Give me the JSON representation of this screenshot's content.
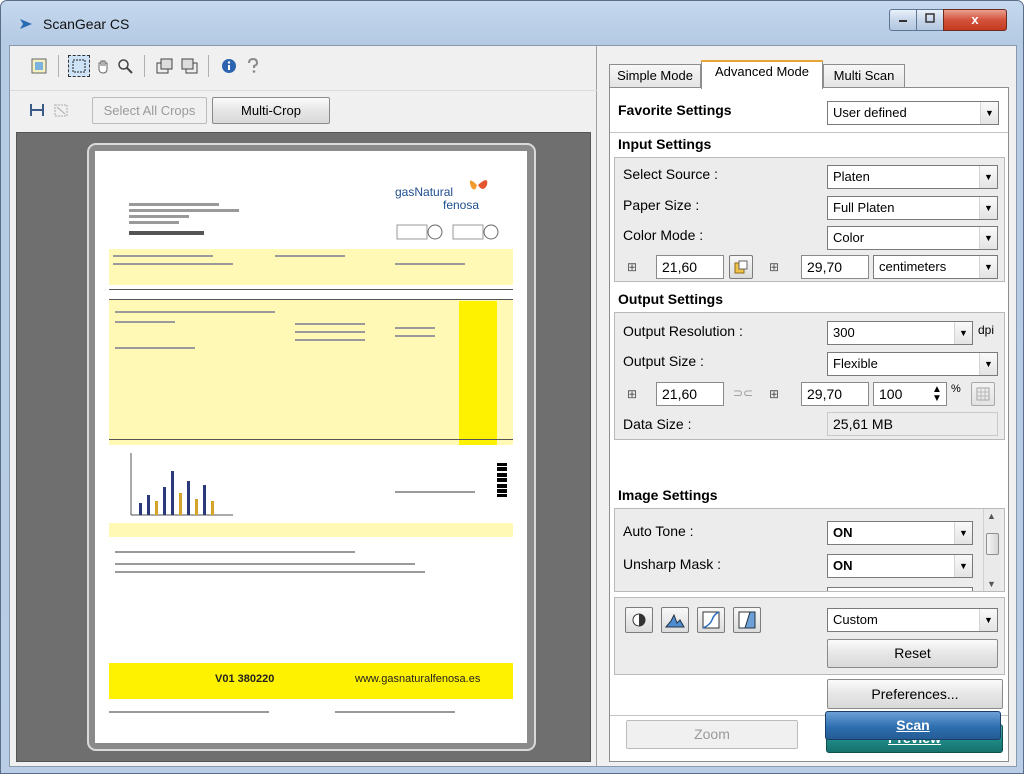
{
  "window": {
    "title": "ScanGear CS",
    "controls": {
      "close_label": "x"
    }
  },
  "left": {
    "toolbar2": {
      "select_all_crops_label": "Select All Crops",
      "multi_crop_label": "Multi-Crop"
    },
    "document": {
      "brand_line1": "gasNatural",
      "brand_line2": "fenosa",
      "footer_code": "V01 380220",
      "footer_url": "www.gasnaturalfenosa.es"
    }
  },
  "tabs": [
    {
      "label": "Simple Mode",
      "active": false
    },
    {
      "label": "Advanced Mode",
      "active": true
    },
    {
      "label": "Multi Scan",
      "active": false
    }
  ],
  "favorite": {
    "label": "Favorite Settings",
    "value": "User defined"
  },
  "input_settings": {
    "title": "Input Settings",
    "select_source": {
      "label": "Select Source :",
      "value": "Platen"
    },
    "paper_size": {
      "label": "Paper Size :",
      "value": "Full Platen"
    },
    "color_mode": {
      "label": "Color Mode :",
      "value": "Color"
    },
    "width": "21,60",
    "height": "29,70",
    "units": "centimeters"
  },
  "output_settings": {
    "title": "Output Settings",
    "resolution": {
      "label": "Output Resolution :",
      "value": "300",
      "unit": "dpi"
    },
    "size": {
      "label": "Output Size :",
      "value": "Flexible"
    },
    "width": "21,60",
    "height": "29,70",
    "scale": "100",
    "scale_unit": "%",
    "data_size": {
      "label": "Data Size :",
      "value": "25,61 MB"
    }
  },
  "image_settings": {
    "title": "Image Settings",
    "auto_tone": {
      "label": "Auto Tone :",
      "value": "ON"
    },
    "unsharp_mask": {
      "label": "Unsharp Mask :",
      "value": "ON"
    }
  },
  "adjust": {
    "preset": "Custom",
    "reset_label": "Reset"
  },
  "buttons": {
    "preferences": "Preferences...",
    "zoom": "Zoom",
    "preview": "Preview",
    "scan": "Scan"
  },
  "colors": {
    "preview_button": "#1f8a86",
    "scan_button": "#2e6fb0",
    "active_tab_accent": "#e8a638"
  }
}
